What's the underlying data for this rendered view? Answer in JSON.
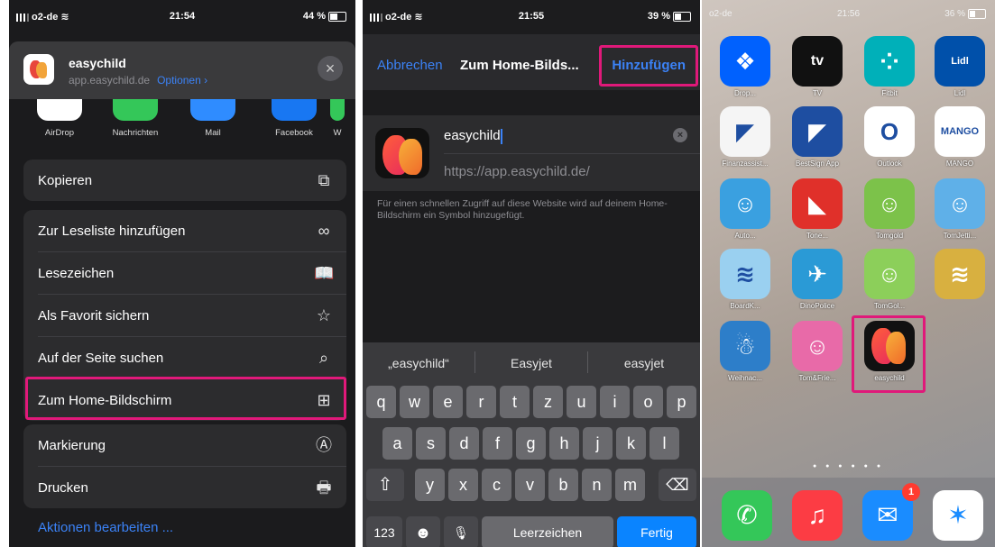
{
  "panel1": {
    "status": {
      "carrier": "o2-de",
      "time": "21:54",
      "battery": "44 %",
      "battery_level": 0.44
    },
    "header": {
      "title": "easychild",
      "subtitle": "app.easychild.de",
      "options": "Optionen",
      "options_chevron": "›",
      "close_icon": "×"
    },
    "share_targets": [
      {
        "label": "AirDrop",
        "color": "#ffffff"
      },
      {
        "label": "Nachrichten",
        "color": "#34c759"
      },
      {
        "label": "Mail",
        "color": "#2f8cff"
      },
      {
        "label": "Facebook",
        "color": "#1877f2"
      },
      {
        "label": "W",
        "color": "#34c759"
      }
    ],
    "copy_label": "Kopieren",
    "actions": [
      {
        "label": "Zur Leseliste hinzufügen",
        "icon": "glasses-icon",
        "glyph": "∞"
      },
      {
        "label": "Lesezeichen",
        "icon": "book-icon",
        "glyph": "📖"
      },
      {
        "label": "Als Favorit sichern",
        "icon": "star-icon",
        "glyph": "☆"
      },
      {
        "label": "Auf der Seite suchen",
        "icon": "search-icon",
        "glyph": "⌕"
      },
      {
        "label": "Zum Home-Bildschirm",
        "icon": "add-square-icon",
        "glyph": "⊞"
      }
    ],
    "actions2": [
      {
        "label": "Markierung",
        "icon": "markup-icon",
        "glyph": "Ⓐ"
      },
      {
        "label": "Drucken",
        "icon": "printer-icon",
        "glyph": "🖶"
      }
    ],
    "edit_actions": "Aktionen bearbeiten ...",
    "highlight_color": "#e0197a"
  },
  "panel2": {
    "status": {
      "carrier": "o2-de",
      "time": "21:55",
      "battery": "39 %",
      "battery_level": 0.39
    },
    "nav": {
      "cancel": "Abbrechen",
      "title": "Zum Home-Bilds...",
      "add": "Hinzufügen"
    },
    "name_value": "easychild",
    "url_value": "https://app.easychild.de/",
    "hint": "Für einen schnellen Zugriff auf diese Website wird auf deinem Home-Bildschirm ein Symbol hinzugefügt.",
    "suggestions": [
      "„easychild“",
      "Easyjet",
      "easyjet"
    ],
    "keyboard": {
      "row1": [
        "q",
        "w",
        "e",
        "r",
        "t",
        "z",
        "u",
        "i",
        "o",
        "p"
      ],
      "row2": [
        "a",
        "s",
        "d",
        "f",
        "g",
        "h",
        "j",
        "k",
        "l"
      ],
      "row3": [
        "y",
        "x",
        "c",
        "v",
        "b",
        "n",
        "m"
      ],
      "shift": "⇧",
      "backspace": "⌫",
      "numbers": "123",
      "emoji": "☻",
      "mic": "🎙",
      "space": "Leerzeichen",
      "done": "Fertig"
    }
  },
  "panel3": {
    "status": {
      "carrier": "o2-de",
      "time": "21:56",
      "battery": "36 %",
      "battery_level": 0.36
    },
    "apps": [
      {
        "label": "Drop...",
        "color": "#0061fe",
        "glyph": "❖"
      },
      {
        "label": "TV",
        "color": "#111111",
        "glyph": "tv"
      },
      {
        "label": "Fitbit",
        "color": "#00b0b9",
        "glyph": "⁘"
      },
      {
        "label": "Lidl",
        "color": "#0050aa",
        "glyph": "Lidl"
      },
      {
        "label": "Finanzassist...",
        "color": "#f5f5f5",
        "glyph": "◤"
      },
      {
        "label": "BestSign App",
        "color": "#1e4ea1",
        "glyph": "◤"
      },
      {
        "label": "Outlook",
        "color": "#ffffff",
        "glyph": "O"
      },
      {
        "label": "MANGO",
        "color": "#ffffff",
        "glyph": "MANGO"
      },
      {
        "label": "Auto...",
        "color": "#3aa0e0",
        "glyph": "☺"
      },
      {
        "label": "Tone...",
        "color": "#e0302a",
        "glyph": "◣"
      },
      {
        "label": "Tomgold",
        "color": "#7cc24a",
        "glyph": "☺"
      },
      {
        "label": "TomJetti...",
        "color": "#5fb0e8",
        "glyph": "☺"
      },
      {
        "label": "BoardK...",
        "color": "#9ad0f0",
        "glyph": "≋"
      },
      {
        "label": "DinoPolice",
        "color": "#2a9ad6",
        "glyph": "✈"
      },
      {
        "label": "TomGol...",
        "color": "#8ccf5a",
        "glyph": "☺"
      },
      {
        "label": "",
        "color": "#d8b040",
        "glyph": "≋"
      },
      {
        "label": "Weihnac...",
        "color": "#2d7ec9",
        "glyph": "☃"
      },
      {
        "label": "Tom&Frie...",
        "color": "#e86aa8",
        "glyph": "☺"
      },
      {
        "label": "easychild",
        "color": "#111111",
        "glyph": "easychild-logo"
      }
    ],
    "dock": [
      {
        "name": "phone",
        "color": "#34c759",
        "glyph": "✆"
      },
      {
        "name": "music",
        "color": "#fc3c44",
        "glyph": "♫"
      },
      {
        "name": "mail",
        "color": "#1a8cff",
        "glyph": "✉",
        "badge": "1"
      },
      {
        "name": "safari",
        "color": "#ffffff",
        "glyph": "✶"
      }
    ]
  }
}
